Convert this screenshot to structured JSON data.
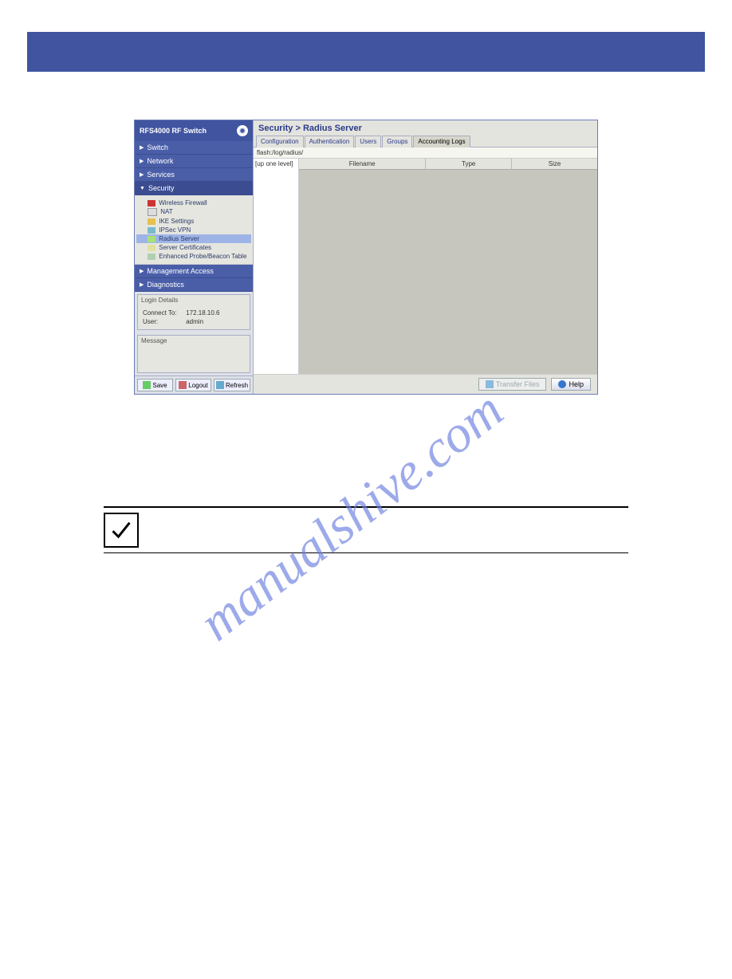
{
  "brand": "RFS4000 RF Switch",
  "watermark": "manualshive.com",
  "nav": {
    "switch": "Switch",
    "network": "Network",
    "services": "Services",
    "security": "Security",
    "mgmt": "Management Access",
    "diag": "Diagnostics"
  },
  "tree": {
    "wireless_firewall": "Wireless Firewall",
    "nat": "NAT",
    "ike": "IKE Settings",
    "ipsec": "IPSec VPN",
    "radius": "Radius Server",
    "certs": "Server Certificates",
    "beacon": "Enhanced Probe/Beacon Table"
  },
  "panels": {
    "login_title": "Login Details",
    "connect_label": "Connect To:",
    "connect_value": "172.18.10.6",
    "user_label": "User:",
    "user_value": "admin",
    "message_title": "Message"
  },
  "footer": {
    "save": "Save",
    "logout": "Logout",
    "refresh": "Refresh"
  },
  "main": {
    "title": "Security > Radius Server",
    "tabs": {
      "config": "Configuration",
      "auth": "Authentication",
      "users": "Users",
      "groups": "Groups",
      "acct": "Accounting Logs"
    },
    "path": "flash:/log/radius/",
    "uplevel": "[up one level]",
    "columns": {
      "filename": "Filename",
      "type": "Type",
      "size": "Size"
    },
    "buttons": {
      "transfer": "Transfer Files",
      "help": "Help"
    }
  }
}
